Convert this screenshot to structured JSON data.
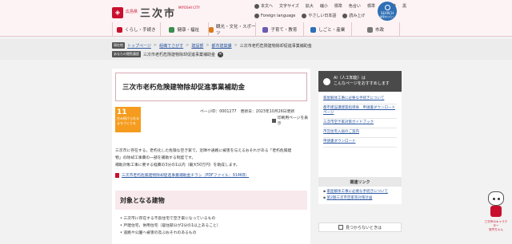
{
  "header": {
    "logo_small": "広島県",
    "logo_text": "三次市",
    "logo_sub": "MIYOSHI CITY",
    "util_row1": [
      "本文へ",
      "文字サイズ",
      "拡大",
      "縮小",
      "標準",
      "色合い",
      "標準",
      "青",
      "黄",
      "黒"
    ],
    "util_row2": [
      "Foreign language",
      "やさしい日本語",
      "読み上げ"
    ],
    "search_label": "SEARCH",
    "search_caption": "検索をひらく"
  },
  "nav": {
    "items": [
      "くらし・手続き",
      "健康・福祉",
      "観光・文化・スポーツ",
      "子育て・教育",
      "しごと・産業",
      "市政"
    ]
  },
  "breadcrumb": {
    "tag1": "現在地",
    "links": [
      "トップページ",
      "組織でさがす",
      "建設部",
      "都市建築課"
    ],
    "current": "三次市老朽危険建物除却促進事業補助金",
    "tag2": "あなたの閲覧履歴",
    "history": "三次市老朽危険建物除却促進事業補助金"
  },
  "main": {
    "title": "三次市老朽危険建物除却促進事業補助金",
    "sdg_number": "11",
    "sdg_text": "住み続けられるまちづくりを",
    "page_id": "ページID：0001277",
    "updated": "更新日：2023年10月26日更新",
    "print_label": "印刷用ページを表示",
    "body_line1": "三次市に存在する，老朽化した危険な空き家で，近隣や通路に被害を与えるおそれがある「老朽危険建",
    "body_line2": "物」の除却工事費の一部を補助する制度です。",
    "body_line3": "補助対象工事に要する経費の3分の1以内（最大50万円）を助成します。",
    "pdf_link": "三次市老朽危険建物除却促進事業補助金チラシ（PDFファイル：914KB）",
    "section_title": "対象となる建物",
    "bullets": [
      "三次市に存在する不良住宅で空き家になっているもの",
      "戸建住宅，併用住宅（居住部分が2分の1以上あること）",
      "道路や公園へ被害の及ぶおそれのあるもの"
    ]
  },
  "sidebar": {
    "ai_title": "AI（人工知能）は",
    "ai_subtitle": "こんなページをおすすめします",
    "ai_links": [
      "家屋解体工事に必要な手続きについて",
      "都市建設課建築指導係　申請書ダウンロードページ",
      "三次市空き家対策ガイドブック",
      "市営住宅入居のご案内",
      "申請書ダウンロード"
    ],
    "related_head": "関連リンク",
    "related_links": [
      "家屋解体工事に必要な手続きについて",
      "第2期三次市空家等対策計画"
    ],
    "feedback": "見つからないときは"
  },
  "mascot": {
    "caption": "三次市のキャラクター\n覚円ちゃん"
  }
}
